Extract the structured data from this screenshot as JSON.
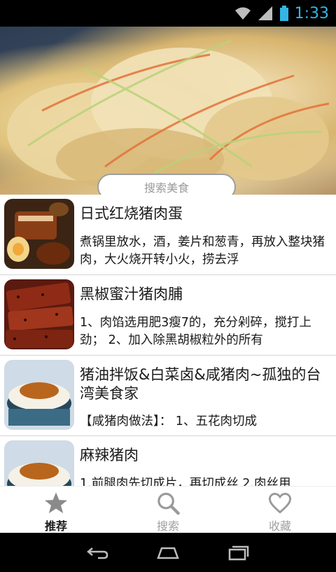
{
  "status_bar": {
    "time": "1:33"
  },
  "search": {
    "placeholder": "搜索美食"
  },
  "recipes": [
    {
      "title": "日式红烧猪肉蛋",
      "desc": "煮锅里放水，酒，姜片和葱青，再放入整块猪肉，大火烧开转小火，捞去浮"
    },
    {
      "title": "黑椒蜜汁猪肉脯",
      "desc": "1、肉馅选用肥3瘦7的，充分剁碎，搅打上劲； 2、加入除黑胡椒粒外的所有"
    },
    {
      "title": "猪油拌饭&白菜卤&咸猪肉~孤独的台湾美食家",
      "desc": "【咸猪肉做法】： 1、五花肉切成"
    },
    {
      "title": "麻辣猪肉",
      "desc": "1.前腿肉先切成片，再切成丝 2.肉丝用"
    }
  ],
  "bottom_nav": {
    "tabs": [
      {
        "label": "推荐",
        "icon": "star-icon",
        "active": true
      },
      {
        "label": "搜索",
        "icon": "search-icon",
        "active": false
      },
      {
        "label": "收藏",
        "icon": "heart-icon",
        "active": false
      }
    ]
  },
  "colors": {
    "status_time": "#33b5e5",
    "active_tab": "#1a1a1a",
    "inactive_tab": "#a0a0a0"
  }
}
